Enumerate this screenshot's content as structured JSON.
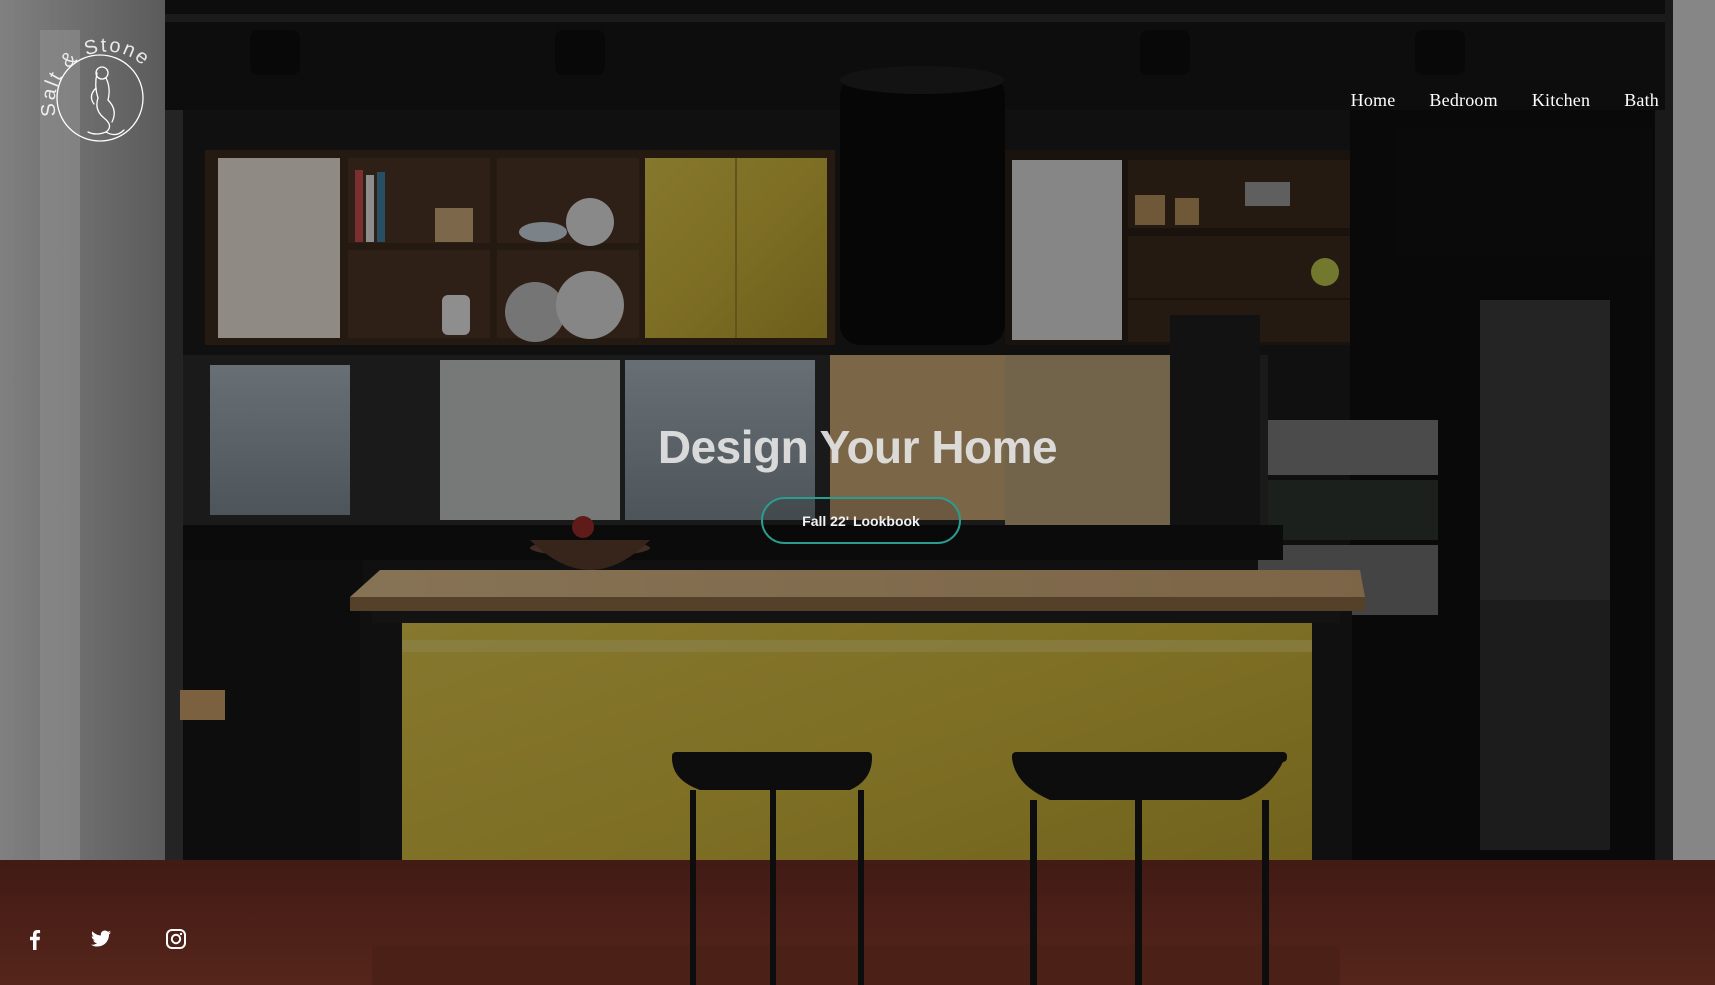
{
  "brand": {
    "name": "Salt & Stone",
    "logo_icon": "mermaid-icon"
  },
  "nav": {
    "items": [
      {
        "label": "Home"
      },
      {
        "label": "Bedroom"
      },
      {
        "label": "Kitchen"
      },
      {
        "label": "Bath"
      }
    ]
  },
  "hero": {
    "title": "Design Your Home",
    "button_label": "Fall 22' Lookbook",
    "background_icon": "kitchen-photo"
  },
  "social": {
    "links": [
      {
        "icon": "facebook-icon"
      },
      {
        "icon": "twitter-icon"
      },
      {
        "icon": "instagram-icon"
      }
    ]
  },
  "colors": {
    "button_border": "#2a9d8f",
    "nav_text": "#ffffff",
    "island_yellow": "#c9b33a"
  }
}
